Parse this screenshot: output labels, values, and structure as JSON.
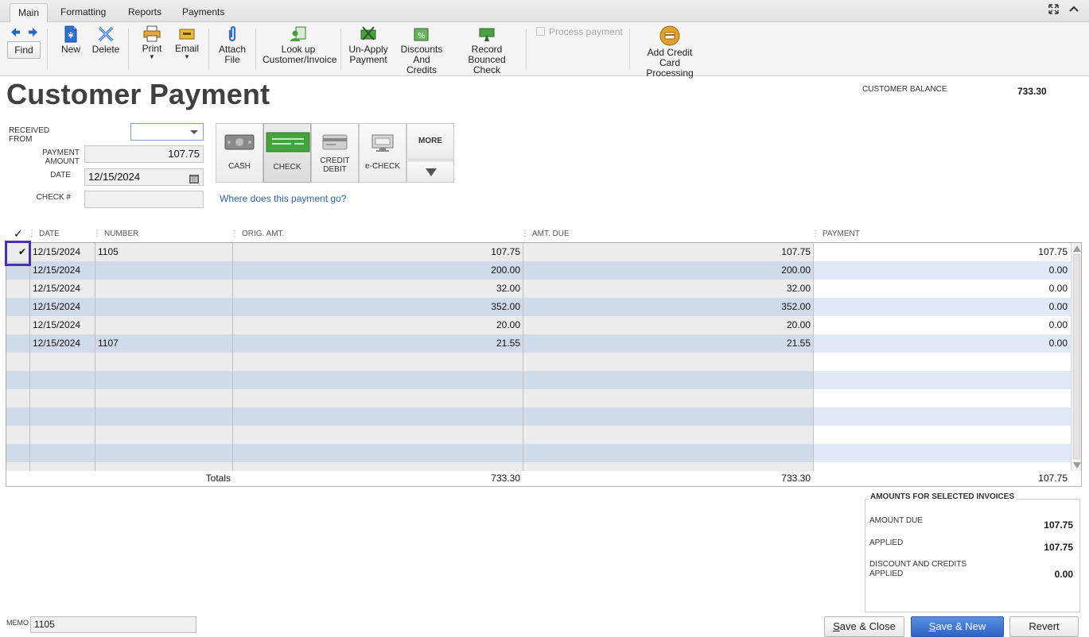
{
  "tabs": [
    {
      "label": "Main",
      "active": true
    },
    {
      "label": "Formatting",
      "active": false
    },
    {
      "label": "Reports",
      "active": false
    },
    {
      "label": "Payments",
      "active": false
    }
  ],
  "window_controls": {
    "expand_icon": "expand-arrows-icon",
    "collapse_icon": "chevron-up-icon"
  },
  "toolbar": {
    "find": "Find",
    "new": "New",
    "delete": "Delete",
    "print": "Print",
    "email": "Email",
    "attach_line1": "Attach",
    "attach_line2": "File",
    "lookup_line1": "Look up",
    "lookup_line2": "Customer/Invoice",
    "unapply_line1": "Un-Apply",
    "unapply_line2": "Payment",
    "discounts_line1": "Discounts And",
    "discounts_line2": "Credits",
    "record_line1": "Record",
    "record_line2": "Bounced Check",
    "process_payment": "Process payment",
    "addcc_line1": "Add Credit Card",
    "addcc_line2": "Processing"
  },
  "header": {
    "title": "Customer Payment",
    "customer_balance_label": "CUSTOMER BALANCE",
    "customer_balance_value": "733.30"
  },
  "form": {
    "received_from_label": "RECEIVED FROM",
    "received_from_value": "",
    "payment_amount_label": "PAYMENT AMOUNT",
    "payment_amount_value": "107.75",
    "date_label": "DATE",
    "date_value": "12/15/2024",
    "check_no_label": "CHECK #",
    "check_no_value": ""
  },
  "payment_methods": {
    "cash": "CASH",
    "check": "CHECK",
    "credit_line1": "CREDIT",
    "credit_line2": "DEBIT",
    "echeck": "e-CHECK",
    "more": "MORE",
    "selected": "CHECK"
  },
  "help_link": "Where does this payment go?",
  "grid": {
    "check_header": "✓",
    "columns": {
      "date": "DATE",
      "number": "NUMBER",
      "orig_amt": "ORIG. AMT.",
      "amt_due": "AMT. DUE",
      "payment": "PAYMENT"
    },
    "rows": [
      {
        "checked": "✔",
        "date": "12/15/2024",
        "number": "1105",
        "orig_amt": "107.75",
        "amt_due": "107.75",
        "payment": "107.75"
      },
      {
        "checked": "",
        "date": "12/15/2024",
        "number": "",
        "orig_amt": "200.00",
        "amt_due": "200.00",
        "payment": "0.00"
      },
      {
        "checked": "",
        "date": "12/15/2024",
        "number": "",
        "orig_amt": "32.00",
        "amt_due": "32.00",
        "payment": "0.00"
      },
      {
        "checked": "",
        "date": "12/15/2024",
        "number": "",
        "orig_amt": "352.00",
        "amt_due": "352.00",
        "payment": "0.00"
      },
      {
        "checked": "",
        "date": "12/15/2024",
        "number": "",
        "orig_amt": "20.00",
        "amt_due": "20.00",
        "payment": "0.00"
      },
      {
        "checked": "",
        "date": "12/15/2024",
        "number": "1107",
        "orig_amt": "21.55",
        "amt_due": "21.55",
        "payment": "0.00"
      }
    ],
    "totals": {
      "label": "Totals",
      "orig_amt": "733.30",
      "amt_due": "733.30",
      "payment": "107.75"
    }
  },
  "amounts_panel": {
    "title": "AMOUNTS FOR SELECTED INVOICES",
    "amount_due_label": "AMOUNT DUE",
    "amount_due_value": "107.75",
    "applied_label": "APPLIED",
    "applied_value": "107.75",
    "discount_label_line1": "DISCOUNT AND CREDITS",
    "discount_label_line2": "APPLIED",
    "discount_value": "0.00"
  },
  "footer": {
    "memo_label": "MEMO",
    "memo_value": "1105",
    "save_close_first": "S",
    "save_close_rest": "ave & Close",
    "save_new_first": "S",
    "save_new_rest": "ave & New",
    "revert": "Revert"
  },
  "colors": {
    "accent_blue": "#2e63c4",
    "link_blue": "#2f62b4",
    "focus_purple": "#4a2fb0",
    "row_blue": "#cfdbe8",
    "row_grey": "#ececec"
  }
}
